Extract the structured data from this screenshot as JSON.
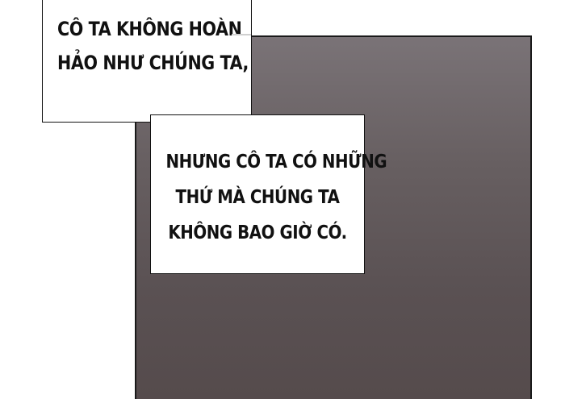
{
  "captions": {
    "top": {
      "lines": [
        "CÔ TA KHÔNG HOÀN",
        "HẢO NHƯ CHÚNG TA,"
      ]
    },
    "middle": {
      "lines": [
        "NHƯNG CÔ TA CÓ NHỮNG",
        "THỨ MÀ CHÚNG TA",
        "KHÔNG BAO GIỜ CÓ."
      ]
    }
  },
  "colors": {
    "panel_top": "#7a7377",
    "panel_bottom": "#554b4c",
    "caption_background": "#ffffff",
    "text": "#111111"
  }
}
